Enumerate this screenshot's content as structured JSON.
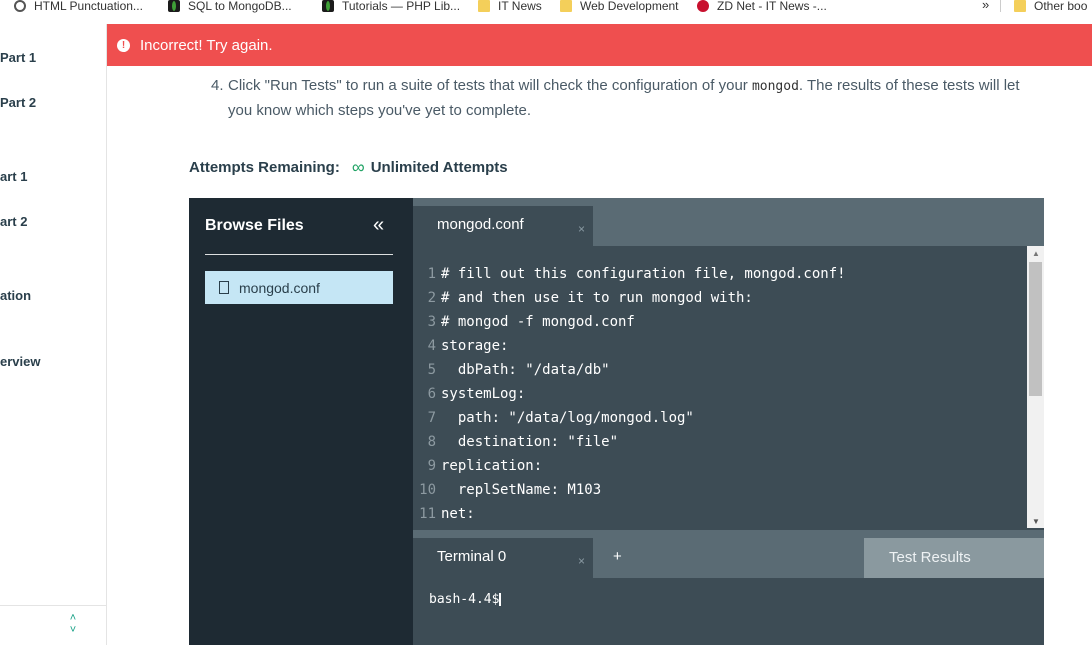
{
  "bookmarks": {
    "items": [
      {
        "label": "HTML Punctuation...",
        "icon": "globe-icon"
      },
      {
        "label": "SQL to MongoDB...",
        "icon": "mongodb-leaf-icon"
      },
      {
        "label": "Tutorials — PHP Lib...",
        "icon": "mongodb-leaf-icon"
      },
      {
        "label": "IT News",
        "icon": "folder-icon"
      },
      {
        "label": "Web Development",
        "icon": "folder-icon"
      },
      {
        "label": "ZD Net - IT News -...",
        "icon": "zdnet-icon"
      }
    ],
    "overflow": "»",
    "other": "Other boo"
  },
  "sidebar": {
    "items": [
      {
        "label": "Part 1"
      },
      {
        "label": "Part 2"
      },
      {
        "label": "art 1"
      },
      {
        "label": "art 2"
      },
      {
        "label": "ation"
      },
      {
        "label": "erview"
      }
    ]
  },
  "banner": {
    "icon": "!",
    "message": "Incorrect! Try again.",
    "color": "#ef4f4f"
  },
  "instructions": {
    "number": "4.",
    "text_before": "Click \"Run Tests\" to run a suite of tests that will check the configuration of your ",
    "code": "mongod",
    "text_after": ". The results of these tests will let you know which steps you've yet to complete."
  },
  "attempts": {
    "label": "Attempts Remaining:",
    "icon": "∞",
    "value": "Unlimited Attempts"
  },
  "browser": {
    "title": "Browse Files",
    "collapse": "«",
    "files": [
      {
        "name": "mongod.conf"
      }
    ]
  },
  "editor": {
    "tab": "mongod.conf",
    "tab_close": "×",
    "lines": [
      {
        "n": "1",
        "text": "# fill out this configuration file, mongod.conf!"
      },
      {
        "n": "2",
        "text": "# and then use it to run mongod with:"
      },
      {
        "n": "3",
        "text": "# mongod -f mongod.conf"
      },
      {
        "n": "4",
        "text": "storage:"
      },
      {
        "n": "5",
        "text": "  dbPath: \"/data/db\""
      },
      {
        "n": "6",
        "text": "systemLog:"
      },
      {
        "n": "7",
        "text": "  path: \"/data/log/mongod.log\""
      },
      {
        "n": "8",
        "text": "  destination: \"file\""
      },
      {
        "n": "9",
        "text": "replication:"
      },
      {
        "n": "10",
        "text": "  replSetName: M103"
      },
      {
        "n": "11",
        "text": "net:"
      }
    ]
  },
  "terminal": {
    "tab": "Terminal 0",
    "tab_close": "×",
    "add": "+",
    "results_button": "Test Results",
    "prompt": "bash-4.4$"
  }
}
